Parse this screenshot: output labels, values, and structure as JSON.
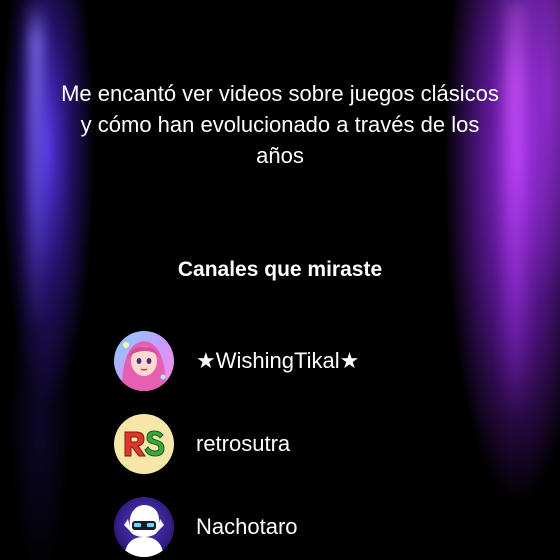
{
  "intro_text": "Me encantó ver videos sobre juegos clásicos y cómo han evolucionado a través de los años",
  "section_title": "Canales que miraste",
  "channels": [
    {
      "name": "★WishingTikal★",
      "avatar_icon": "anime-girl-avatar-icon"
    },
    {
      "name": "retrosutra",
      "avatar_icon": "rs-logo-avatar-icon"
    },
    {
      "name": "Nachotaro",
      "avatar_icon": "masked-character-avatar-icon"
    }
  ],
  "colors": {
    "background": "#000000",
    "left_glow": "#5834EB",
    "right_glow": "#A630F0",
    "text": "#FFFFFF"
  }
}
